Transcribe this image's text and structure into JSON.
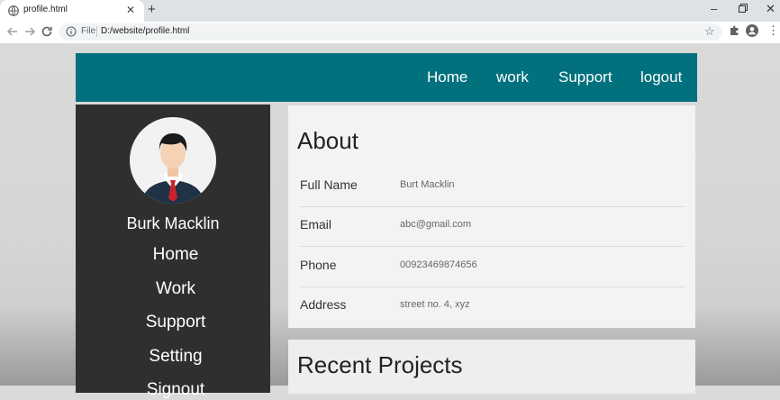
{
  "browser": {
    "tab_title": "profile.html",
    "file_label": "File",
    "url": "D:/website/profile.html"
  },
  "topnav": {
    "items": [
      "Home",
      "work",
      "Support",
      "logout"
    ]
  },
  "sidebar": {
    "user_name": "Burk Macklin",
    "items": [
      "Home",
      "Work",
      "Support",
      "Setting",
      "Signout"
    ]
  },
  "about": {
    "title": "About",
    "rows": [
      {
        "label": "Full Name",
        "value": "Burt Macklin"
      },
      {
        "label": "Email",
        "value": "abc@gmail.com"
      },
      {
        "label": "Phone",
        "value": "00923469874656"
      },
      {
        "label": "Address",
        "value": "street no. 4, xyz"
      }
    ]
  },
  "projects": {
    "title": "Recent Projects"
  },
  "colors": {
    "nav_teal": "#02717e",
    "sidebar_dark": "#2f2f2f",
    "card_bg": "#f3f3f3"
  }
}
